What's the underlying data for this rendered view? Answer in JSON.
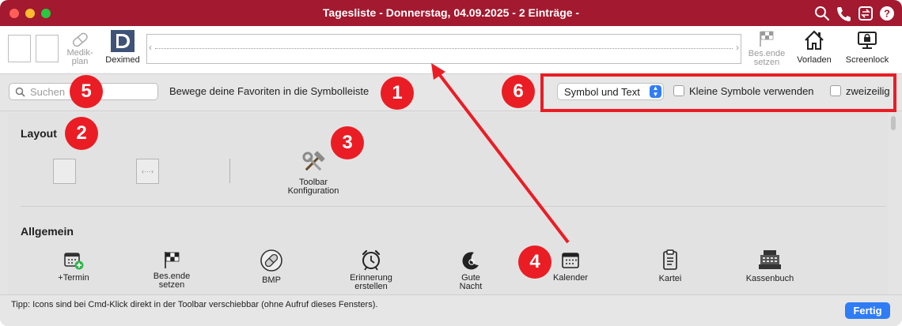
{
  "window": {
    "title": "Tagesliste - Donnerstag, 04.09.2025 - 2 Einträge -"
  },
  "toolbar": {
    "medikplan": "Medik-\nplan",
    "deximed": "Deximed",
    "besende": "Bes.ende\nsetzen",
    "vorladen": "Vorladen",
    "screenlock": "Screenlock"
  },
  "options": {
    "search_placeholder": "Suchen",
    "hint": "Bewege deine Favoriten in die Symbolleiste",
    "display_mode": "Symbol und Text",
    "small_icons": "Kleine Symbole verwenden",
    "two_line": "zweizeilig"
  },
  "sections": {
    "layout": {
      "title": "Layout",
      "toolbar_config": "Toolbar\nKonfiguration"
    },
    "allgemein": {
      "title": "Allgemein",
      "items": [
        {
          "label": "+Termin",
          "icon": "calendar-add-icon"
        },
        {
          "label": "Bes.ende\nsetzen",
          "icon": "checkered-flag-icon"
        },
        {
          "label": "BMP",
          "icon": "pill-icon"
        },
        {
          "label": "Erinnerung\nerstellen",
          "icon": "alarm-clock-icon"
        },
        {
          "label": "Gute\nNacht",
          "icon": "moon-power-icon"
        },
        {
          "label": "Kalender",
          "icon": "calendar-icon"
        },
        {
          "label": "Kartei",
          "icon": "clipboard-icon"
        },
        {
          "label": "Kassenbuch",
          "icon": "cash-register-icon"
        }
      ]
    }
  },
  "footer": {
    "tip": "Tipp: Icons sind bei Cmd-Klick direkt in der Toolbar verschiebbar (ohne Aufruf dieses Fensters).",
    "done": "Fertig"
  },
  "annotations": {
    "b1": "1",
    "b2": "2",
    "b3": "3",
    "b4": "4",
    "b5": "5",
    "b6": "6"
  },
  "colors": {
    "titlebar": "#a3192f",
    "accent": "#2f7cf6",
    "annotation": "#ea1d25"
  }
}
